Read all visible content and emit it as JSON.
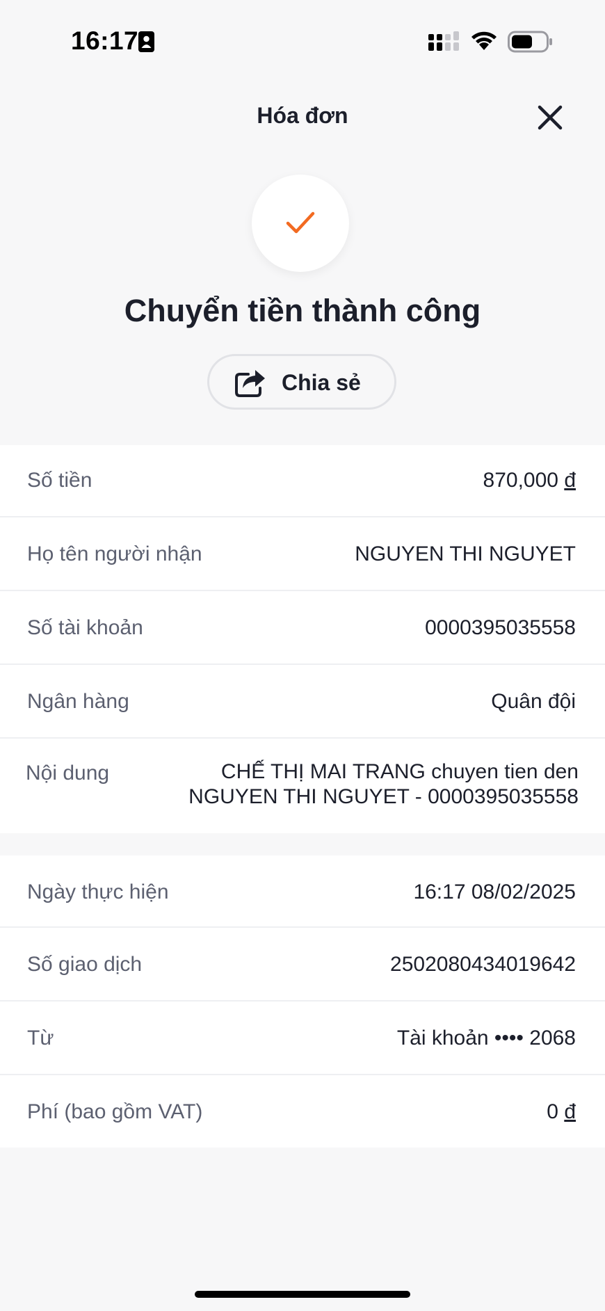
{
  "status_bar": {
    "time": "16:17"
  },
  "header": {
    "title": "Hóa đơn"
  },
  "success": {
    "title": "Chuyển tiền thành công",
    "accent_color": "#f26a21"
  },
  "share_button": {
    "label": "Chia sẻ"
  },
  "details": {
    "amount": {
      "label": "Số tiền",
      "value": "870,000",
      "currency": "đ"
    },
    "recipient_name": {
      "label": "Họ tên người nhận",
      "value": "NGUYEN THI NGUYET"
    },
    "account_number": {
      "label": "Số tài khoản",
      "value": "0000395035558"
    },
    "bank": {
      "label": "Ngân hàng",
      "value": "Quân đội"
    },
    "content": {
      "label": "Nội dung",
      "line1": "CHẾ THỊ MAI TRANG chuyen tien den",
      "line2": "NGUYEN THI NGUYET - 0000395035558"
    }
  },
  "transaction": {
    "date": {
      "label": "Ngày thực hiện",
      "value": "16:17 08/02/2025"
    },
    "transaction_id": {
      "label": "Số giao dịch",
      "value": "2502080434019642"
    },
    "from": {
      "label": "Từ",
      "value": "Tài khoản •••• 2068"
    },
    "fee": {
      "label": "Phí (bao gồm VAT)",
      "value": "0",
      "currency": "đ"
    }
  }
}
